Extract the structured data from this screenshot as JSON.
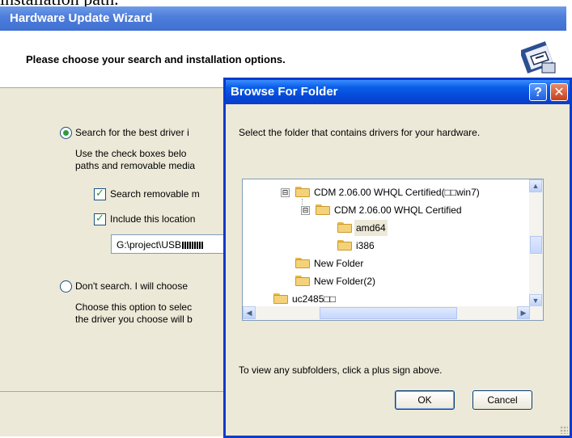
{
  "document": {
    "text": "installation path."
  },
  "wizard": {
    "title": "Hardware Update Wizard",
    "header_title": "Please choose your search and installation options.",
    "option_search_label": "Search for the best driver i",
    "option_search_desc_line1": "Use the check boxes belo",
    "option_search_desc_line2": "paths and removable media",
    "checkbox_removable_label": "Search removable m",
    "checkbox_include_label": "Include this location",
    "path_value": "G:\\project\\USB",
    "option_dont_search_label": "Don't search. I will choose",
    "option_dont_desc_line1": "Choose this option to selec",
    "option_dont_desc_line2": "the driver you choose will b"
  },
  "dialog": {
    "title": "Browse For Folder",
    "help_button": "?",
    "close_button": "✕",
    "instruction": "Select the folder that contains drivers for your hardware.",
    "tree": [
      {
        "label": "CDM 2.06.00 WHQL Certified(□□win7)",
        "expander": "⊟",
        "selected": false
      },
      {
        "label": "CDM 2.06.00 WHQL Certified",
        "expander": "⊟",
        "selected": false
      },
      {
        "label": "amd64",
        "expander": "",
        "selected": true
      },
      {
        "label": "i386",
        "expander": "",
        "selected": false
      },
      {
        "label": "New Folder",
        "expander": "",
        "selected": false
      },
      {
        "label": "New Folder(2)",
        "expander": "",
        "selected": false
      },
      {
        "label": "uc2485□□",
        "expander": "",
        "selected": false
      }
    ],
    "hint": "To view any subfolders, click a plus sign above.",
    "ok_label": "OK",
    "cancel_label": "Cancel"
  },
  "colors": {
    "titlebar_blue": "#0a5ee8",
    "dialog_bg": "#ece9d8",
    "check_green": "#21a121"
  }
}
